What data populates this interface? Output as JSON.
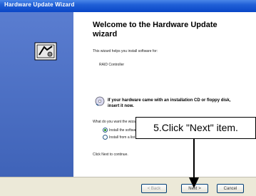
{
  "window": {
    "title": "Hardware Update Wizard"
  },
  "wizard": {
    "heading": "Welcome to the Hardware Update wizard",
    "intro": "This wizard helps you install software for:",
    "device": "RAID Controller",
    "cd_hint": "If your hardware came with an installation CD or floppy disk, insert it now.",
    "question": "What do you want the wizard to do?",
    "option_auto": "Install the software automatically (Recommended)",
    "option_manual": "Install from a list or specific location (Advanced)",
    "continue_hint": "Click Next to continue."
  },
  "buttons": {
    "back": "< Back",
    "next": "Next >",
    "cancel": "Cancel"
  },
  "annotation": {
    "callout": "5.Click \"Next\" item."
  }
}
